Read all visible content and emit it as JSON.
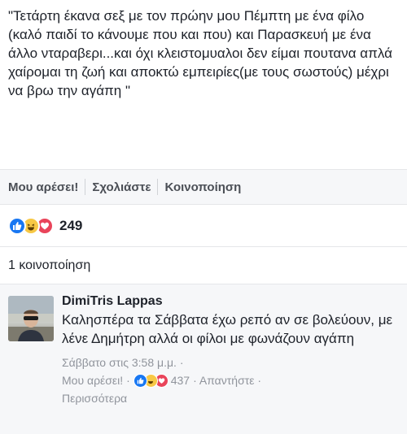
{
  "post": {
    "text": "\"Τετάρτη έκανα σεξ με τον πρώην μου Πέμπτη με ένα φίλο (καλό παιδί το κάνουμε που και που) και Παρασκευή με ένα άλλο νταραβερι...και όχι κλειστομυαλοι δεν είμαι πουτανα απλά χαίρομαι τη ζωή και αποκτώ εμπειρίες(με τους σωστούς) μέχρι να βρω την αγάπη \""
  },
  "actions": {
    "like": "Μου αρέσει!",
    "comment": "Σχολιάστε",
    "share": "Κοινοποίηση"
  },
  "reactions": {
    "icons": [
      "like-icon",
      "haha-icon",
      "love-icon"
    ],
    "count": "249"
  },
  "shares": {
    "label": "1 κοινοποίηση"
  },
  "comment": {
    "author": "DimiTris Lappas",
    "text": "Καλησπέρα τα Σάββατα έχω ρεπό αν σε βολεύουν, με λένε Δημήτρη αλλά οι φίλοι με φωνάζουν αγάπη",
    "timestamp": "Σάββατο στις 3:58 μ.μ. ·",
    "like_label": "Μου αρέσει! ·",
    "reaction_count": "437",
    "reply_label": "· Απαντήστε ·",
    "more_label": "Περισσότερα"
  },
  "colors": {
    "like": "#1877f2",
    "haha": "#f7c845",
    "love": "#e9445a",
    "meta_gray": "#90949c"
  }
}
